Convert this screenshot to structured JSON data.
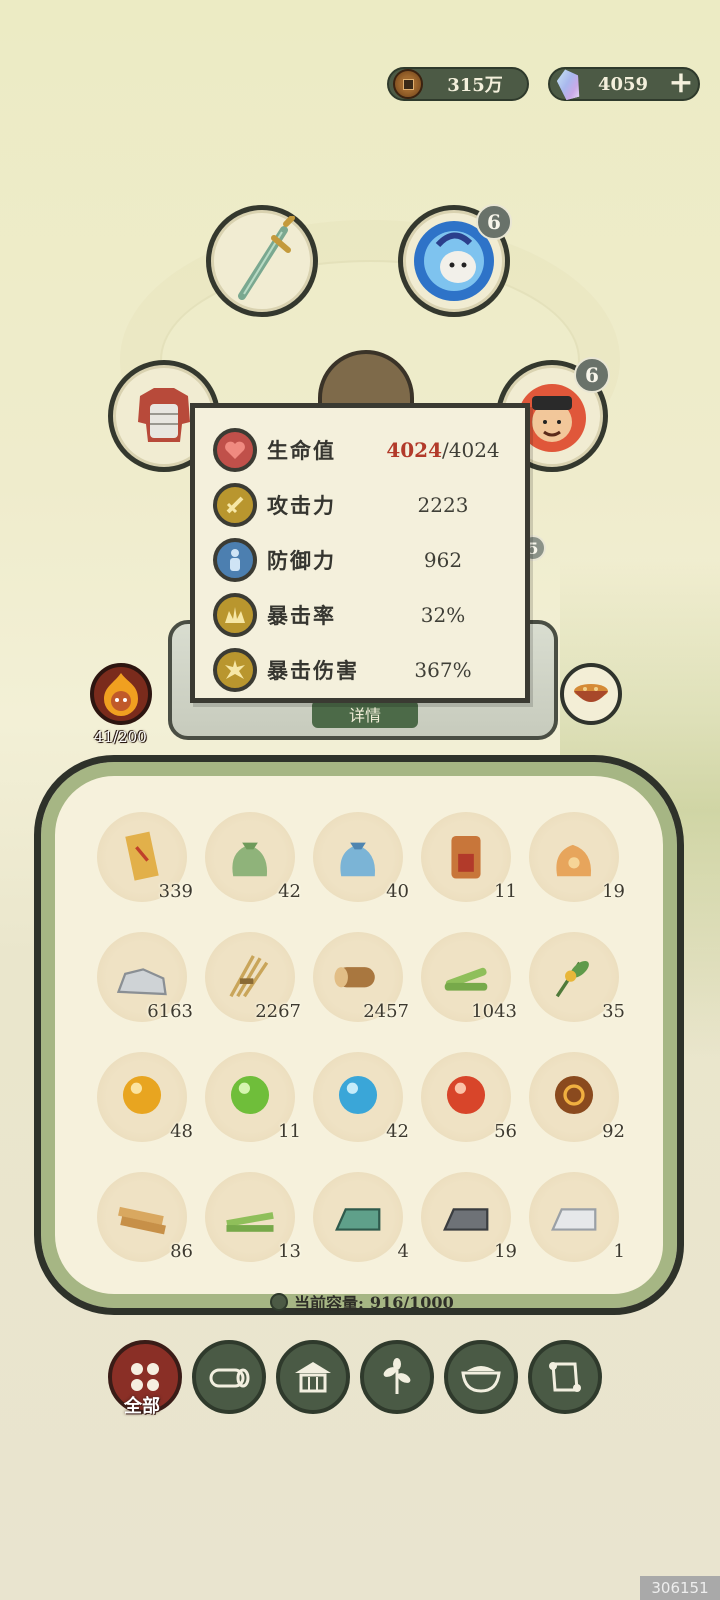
{
  "currency": {
    "coins": "315万",
    "gems": "4059",
    "coin_icon": "copper-coin-icon",
    "gem_icon": "spirit-crystal-icon",
    "plus_icon": "plus-icon"
  },
  "equipment": {
    "weapon_icon": "jade-sword-icon",
    "pet_icon": "blue-spirit-pet-icon",
    "pet_badge": "6",
    "armor_icon": "red-armor-icon",
    "companion_icon": "official-portrait-icon",
    "companion_badge": "6",
    "hidden_badge": "5"
  },
  "stats": [
    {
      "icon": "heart-icon",
      "label": "生命值",
      "value_current": "4024",
      "value_max": "/4024",
      "color": "#c0504a"
    },
    {
      "icon": "attack-icon",
      "label": "攻击力",
      "value": "2223",
      "color": "#b9962e"
    },
    {
      "icon": "defense-icon",
      "label": "防御力",
      "value": "962",
      "color": "#4c7fb0"
    },
    {
      "icon": "crit-rate-icon",
      "label": "暴击率",
      "value": "32%",
      "color": "#b9962e"
    },
    {
      "icon": "crit-damage-icon",
      "label": "暴击伤害",
      "value": "367%",
      "color": "#b9962e"
    }
  ],
  "detail_button": "详情",
  "level": "41/200",
  "side_icon": "food-bowl-icon",
  "inventory": {
    "items": [
      {
        "icon": "scroll-talisman-icon",
        "count": "339"
      },
      {
        "icon": "green-pouch-icon",
        "count": "42"
      },
      {
        "icon": "blue-pouch-icon",
        "count": "40"
      },
      {
        "icon": "demon-mask-token-icon",
        "count": "11"
      },
      {
        "icon": "orange-pouch-icon",
        "count": "19"
      },
      {
        "icon": "stone-icon",
        "count": "6163"
      },
      {
        "icon": "straw-bundle-icon",
        "count": "2267"
      },
      {
        "icon": "wood-log-icon",
        "count": "2457"
      },
      {
        "icon": "bamboo-icon",
        "count": "1043"
      },
      {
        "icon": "herb-flower-icon",
        "count": "35"
      },
      {
        "icon": "gold-orb-icon",
        "count": "48"
      },
      {
        "icon": "green-orb-icon",
        "count": "11"
      },
      {
        "icon": "blue-orb-icon",
        "count": "42"
      },
      {
        "icon": "red-orb-icon",
        "count": "56"
      },
      {
        "icon": "brown-orb-icon",
        "count": "92"
      },
      {
        "icon": "wood-plank-icon",
        "count": "86"
      },
      {
        "icon": "bamboo-plank-icon",
        "count": "13"
      },
      {
        "icon": "jade-ingot-icon",
        "count": "4"
      },
      {
        "icon": "iron-ingot-icon",
        "count": "19"
      },
      {
        "icon": "silver-ingot-icon",
        "count": "1"
      }
    ],
    "capacity_label": "当前容量:",
    "capacity_value": "916/1000"
  },
  "tabs": [
    {
      "icon": "all-grid-icon",
      "label": "全部",
      "active": true
    },
    {
      "icon": "log-icon"
    },
    {
      "icon": "house-icon"
    },
    {
      "icon": "leaf-icon"
    },
    {
      "icon": "rice-bowl-icon"
    },
    {
      "icon": "scroll-icon"
    }
  ],
  "watermark": "306151",
  "colors": {
    "accent_red": "#b23a2a",
    "dark_green": "#4c5a45",
    "panel_bg": "#f4f0dc"
  }
}
